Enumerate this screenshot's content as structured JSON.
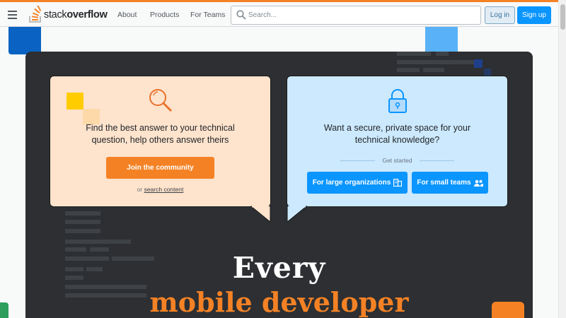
{
  "header": {
    "logo_text_light": "stack",
    "logo_text_bold": "overflow",
    "nav": [
      "About",
      "Products",
      "For Teams"
    ],
    "search_placeholder": "Search...",
    "login_label": "Log in",
    "signup_label": "Sign up"
  },
  "card_community": {
    "icon": "magnifier-icon",
    "text_line1": "Find the best answer to your technical",
    "text_line2": "question, help others answer theirs",
    "button_label": "Join the community",
    "or_prefix": "or",
    "or_link": "search content"
  },
  "card_teams": {
    "icon": "lock-icon",
    "text_line1": "Want a secure, private space for your",
    "text_line2": "technical knowledge?",
    "get_started": "Get started",
    "btn_large": "For large organizations",
    "btn_small": "For small teams"
  },
  "hero": {
    "headline_line1": "Every",
    "headline_line2": "mobile developer"
  },
  "colors": {
    "brand_orange": "#f48225",
    "brand_blue": "#0a95ff",
    "hero_bg": "#2d2f32",
    "card_orange_bg": "#fee3cd",
    "card_blue_bg": "#cce9fe"
  }
}
